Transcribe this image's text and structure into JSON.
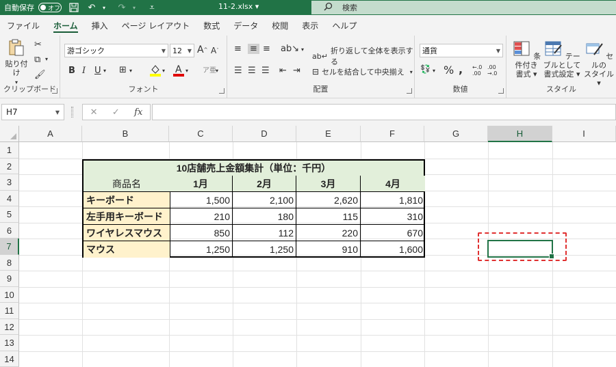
{
  "titlebar": {
    "autosave_label": "自動保存",
    "autosave_state": "オフ",
    "filename": "11-2.xlsx",
    "search_placeholder": "検索"
  },
  "tabs": [
    "ファイル",
    "ホーム",
    "挿入",
    "ページ レイアウト",
    "数式",
    "データ",
    "校閲",
    "表示",
    "ヘルプ"
  ],
  "active_tab": "ホーム",
  "ribbon": {
    "clipboard": {
      "label": "クリップボード",
      "paste": "貼り付け"
    },
    "font": {
      "label": "フォント",
      "name": "游ゴシック",
      "size": "12"
    },
    "alignment": {
      "label": "配置",
      "wrap": "折り返して全体を表示する",
      "merge": "セルを結合して中央揃え"
    },
    "number": {
      "label": "数値",
      "format": "通貨"
    },
    "styles": {
      "label": "スタイル",
      "cond_line1": "条件付き",
      "cond_line2": "書式",
      "table_line1": "テーブルとして",
      "table_line2": "書式設定",
      "cell_line1": "セルの",
      "cell_line2": "スタイル"
    }
  },
  "formula_bar": {
    "name_box": "H7",
    "fx": "fx"
  },
  "columns": [
    "A",
    "B",
    "C",
    "D",
    "E",
    "F",
    "G",
    "H",
    "I"
  ],
  "selected_column": "H",
  "rows": [
    "1",
    "2",
    "3",
    "4",
    "5",
    "6",
    "7",
    "8",
    "9",
    "10",
    "11",
    "12",
    "13",
    "14"
  ],
  "selected_row": "7",
  "table": {
    "title": "10店舗売上金額集計（単位：千円）",
    "header": [
      "商品名",
      "1月",
      "2月",
      "3月",
      "4月"
    ],
    "rows": [
      {
        "name": "キーボード",
        "values": [
          "1,500",
          "2,100",
          "2,620",
          "1,810"
        ]
      },
      {
        "name": "左手用キーボード",
        "values": [
          "210",
          "180",
          "115",
          "310"
        ]
      },
      {
        "name": "ワイヤレスマウス",
        "values": [
          "850",
          "112",
          "220",
          "670"
        ]
      },
      {
        "name": "マウス",
        "values": [
          "1,250",
          "1,250",
          "910",
          "1,600"
        ]
      }
    ]
  },
  "colors": {
    "excel_green": "#217346",
    "header_fill": "#e2efda",
    "name_fill": "#fff2cc",
    "highlight": "#e03030"
  }
}
